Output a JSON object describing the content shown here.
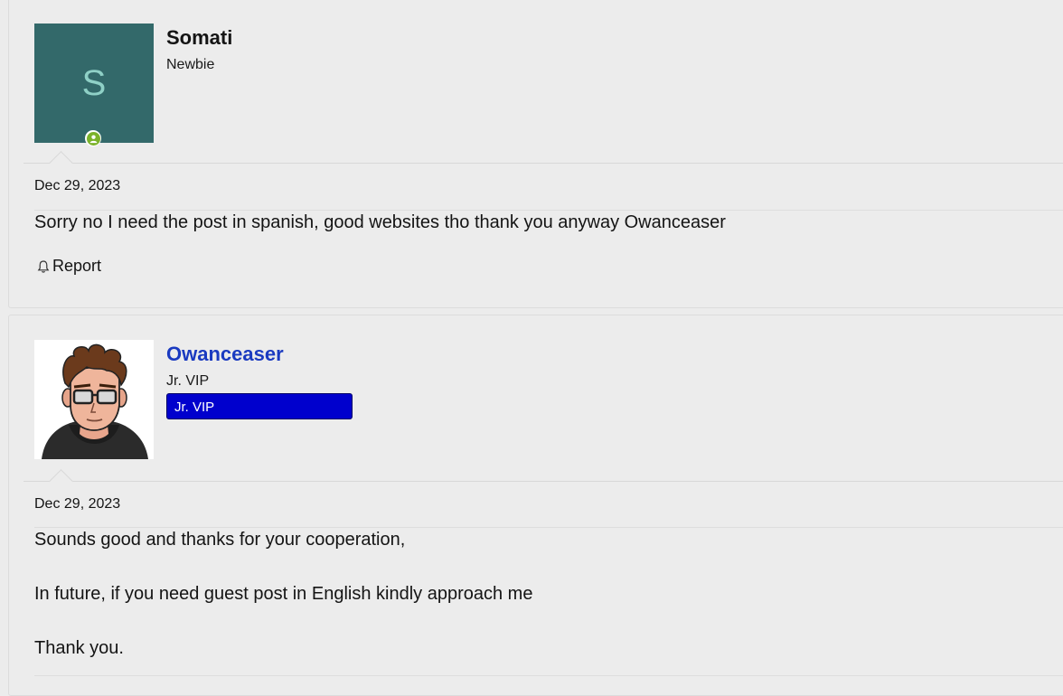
{
  "posts": [
    {
      "username": "Somati",
      "user_title": "Newbie",
      "avatar_letter": "S",
      "date": "Dec 29, 2023",
      "body": [
        "Sorry no I need the post in spanish, good websites tho thank you anyway Owanceaser"
      ],
      "report_label": "Report"
    },
    {
      "username": "Owanceaser",
      "user_title": "Jr. VIP",
      "banner": "Jr. VIP",
      "date": "Dec 29, 2023",
      "body": [
        "Sounds good and thanks for your cooperation,",
        "In future, if you need guest post in English kindly approach me",
        "Thank you."
      ]
    }
  ],
  "colors": {
    "avatar_bg": "#33696a",
    "avatar_letter": "#8fd0c6",
    "username_link": "#1a3ac0",
    "banner_bg": "#0000cd",
    "online": "#7bb22a"
  },
  "icons": [
    "online-status-icon",
    "bell-icon"
  ]
}
